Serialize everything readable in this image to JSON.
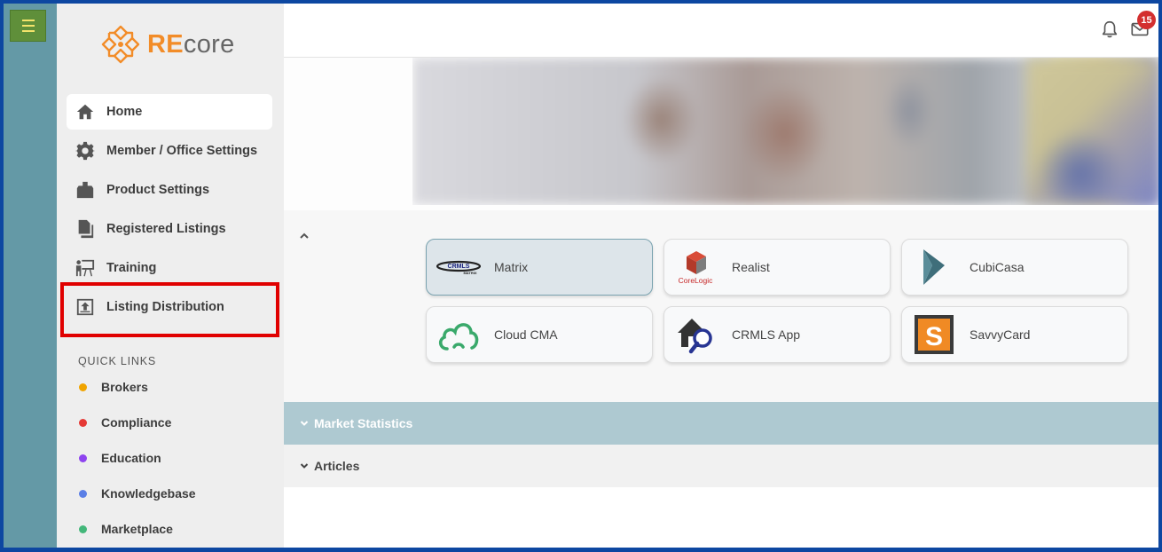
{
  "brand": {
    "re": "RE",
    "core": "core",
    "accent_color": "#f28c28"
  },
  "nav": {
    "items": [
      {
        "label": "Home",
        "icon": "home-icon",
        "active": true
      },
      {
        "label": "Member / Office Settings",
        "icon": "gear-icon"
      },
      {
        "label": "Product Settings",
        "icon": "product-box-icon"
      },
      {
        "label": "Registered Listings",
        "icon": "documents-icon"
      },
      {
        "label": "Training",
        "icon": "presentation-icon"
      },
      {
        "label": "Listing Distribution",
        "icon": "upload-icon"
      }
    ]
  },
  "quick_links": {
    "title": "QUICK LINKS",
    "items": [
      {
        "label": "Brokers",
        "color": "#f0a400"
      },
      {
        "label": "Compliance",
        "color": "#e53935"
      },
      {
        "label": "Education",
        "color": "#8e44ef"
      },
      {
        "label": "Knowledgebase",
        "color": "#5b7fe6"
      },
      {
        "label": "Marketplace",
        "color": "#43b77a"
      }
    ]
  },
  "header": {
    "mail_count": "15"
  },
  "apps": [
    {
      "name": "Matrix",
      "logo": "crmls-matrix-logo",
      "selected": true
    },
    {
      "name": "Realist",
      "logo": "corelogic-logo"
    },
    {
      "name": "CubiCasa",
      "logo": "cubicasa-logo"
    },
    {
      "name": "Cloud CMA",
      "logo": "cloud-cma-logo"
    },
    {
      "name": "CRMLS App",
      "logo": "crmls-app-logo"
    },
    {
      "name": "SavvyCard",
      "logo": "savvycard-logo"
    }
  ],
  "logo_text": {
    "crmls": "CRMLS",
    "matrix": "MATRIX",
    "corelogic": "CoreLogic",
    "savvy_letter": "S"
  },
  "sections": {
    "market_statistics": "Market Statistics",
    "articles": "Articles"
  },
  "colors": {
    "rail": "#6499a6",
    "hamburger": "#5f8f3a",
    "market_header": "#aec9d1",
    "highlight_box": "#e00000"
  }
}
